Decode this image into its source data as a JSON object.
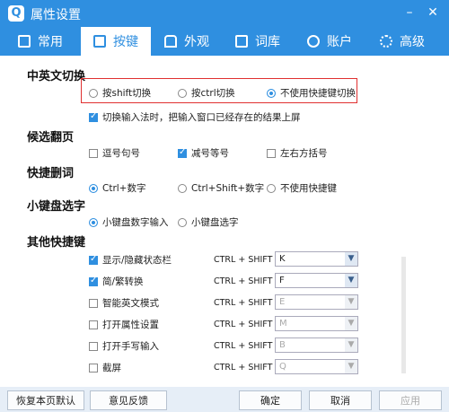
{
  "window": {
    "title": "属性设置",
    "logo": "Q"
  },
  "tabs": [
    {
      "label": "常用",
      "icon": "monitor-icon"
    },
    {
      "label": "按键",
      "icon": "keyboard-icon"
    },
    {
      "label": "外观",
      "icon": "shirt-icon"
    },
    {
      "label": "词库",
      "icon": "book-icon"
    },
    {
      "label": "账户",
      "icon": "user-icon"
    },
    {
      "label": "高级",
      "icon": "gear-icon"
    }
  ],
  "sections": {
    "cn_en_switch": {
      "title": "中英文切换",
      "options": [
        "按shift切换",
        "按ctrl切换",
        "不使用快捷键切换"
      ],
      "selected": "不使用快捷键切换",
      "checkbox_label": "切换输入法时，把输入窗口已经存在的结果上屏",
      "checkbox_checked": true
    },
    "page_flip": {
      "title": "候选翻页",
      "options": [
        {
          "label": "逗号句号",
          "checked": false
        },
        {
          "label": "减号等号",
          "checked": true
        },
        {
          "label": "左右方括号",
          "checked": false
        }
      ]
    },
    "quick_delete": {
      "title": "快捷删词",
      "options": [
        "Ctrl+数字",
        "Ctrl+Shift+数字",
        "不使用快捷键"
      ],
      "selected": "Ctrl+数字"
    },
    "numpad_select": {
      "title": "小键盘选字",
      "options": [
        "小键盘数字输入",
        "小键盘选字"
      ],
      "selected": "小键盘数字输入"
    },
    "other_shortcuts": {
      "title": "其他快捷键",
      "items": [
        {
          "label": "显示/隐藏状态栏",
          "checked": true,
          "combo": "CTRL + SHIFT +",
          "key": "K",
          "enabled": true
        },
        {
          "label": "简/繁转换",
          "checked": true,
          "combo": "CTRL + SHIFT +",
          "key": "F",
          "enabled": true
        },
        {
          "label": "智能英文模式",
          "checked": false,
          "combo": "CTRL + SHIFT +",
          "key": "E",
          "enabled": false
        },
        {
          "label": "打开属性设置",
          "checked": false,
          "combo": "CTRL + SHIFT +",
          "key": "M",
          "enabled": false
        },
        {
          "label": "打开手写输入",
          "checked": false,
          "combo": "CTRL + SHIFT +",
          "key": "B",
          "enabled": false
        },
        {
          "label": "截屏",
          "checked": false,
          "combo": "CTRL + SHIFT +",
          "key": "Q",
          "enabled": false
        }
      ]
    }
  },
  "footer": {
    "restore_label": "恢复本页默认",
    "feedback_label": "意见反馈",
    "ok_label": "确定",
    "cancel_label": "取消",
    "apply_label": "应用"
  },
  "colors": {
    "accent": "#2f8fe0",
    "highlight_box": "#e03030"
  }
}
